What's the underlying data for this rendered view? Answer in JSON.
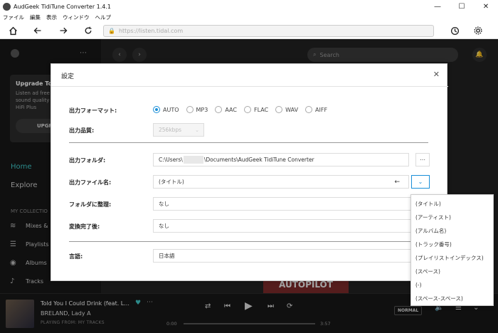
{
  "window": {
    "title": "AudGeek TidiTune Converter 1.4.1",
    "controls": [
      "—",
      "☐",
      "✕"
    ]
  },
  "menubar": [
    "ファイル",
    "編集",
    "表示",
    "ウィンドウ",
    "ヘルプ"
  ],
  "navbar": {
    "url": "https://listen.tidal.com"
  },
  "sidebar": {
    "upgrade_title": "Upgrade Too",
    "upgrade_text": [
      "Listen ad free",
      "sound quality",
      "HiFi Plus"
    ],
    "upgrade_button": "UPGR",
    "home": "Home",
    "explore": "Explore",
    "section": "MY COLLECTIO",
    "items": [
      "Mixes &",
      "Playlists",
      "Albums",
      "Tracks"
    ]
  },
  "main": {
    "search_placeholder": "Search",
    "album_text": "AUTOPILOT"
  },
  "player": {
    "title": "Told You I Could Drink (feat. L...",
    "artist": "BRELAND, Lady A",
    "from": "PLAYING FROM: MY TRACKS",
    "time_current": "0:00",
    "time_total": "3:57",
    "progress": 0,
    "mode": "NORMAL"
  },
  "dialog": {
    "title": "設定",
    "format_label": "出力フォーマット:",
    "formats": [
      "AUTO",
      "MP3",
      "AAC",
      "FLAC",
      "WAV",
      "AIFF"
    ],
    "format_selected": "AUTO",
    "quality_label": "出力品質:",
    "quality_value": "256kbps",
    "folder_label": "出力フォルダ:",
    "folder_prefix": "C:\\Users\\",
    "folder_suffix": "\\Documents\\AudGeek TidiTune Converter",
    "filename_label": "出力ファイル名:",
    "filename_value": "(タイトル)",
    "organize_label": "フォルダに整理:",
    "organize_value": "なし",
    "after_label": "変換完了後:",
    "after_value": "なし",
    "language_label": "言語:",
    "language_value": "日本語",
    "dropdown_options": [
      "(タイトル)",
      "(アーティスト)",
      "(アルバム名)",
      "(トラック番号)",
      "(プレイリストインデックス)",
      "(スペース)",
      "(-)",
      "(スペース-スペース)"
    ]
  }
}
